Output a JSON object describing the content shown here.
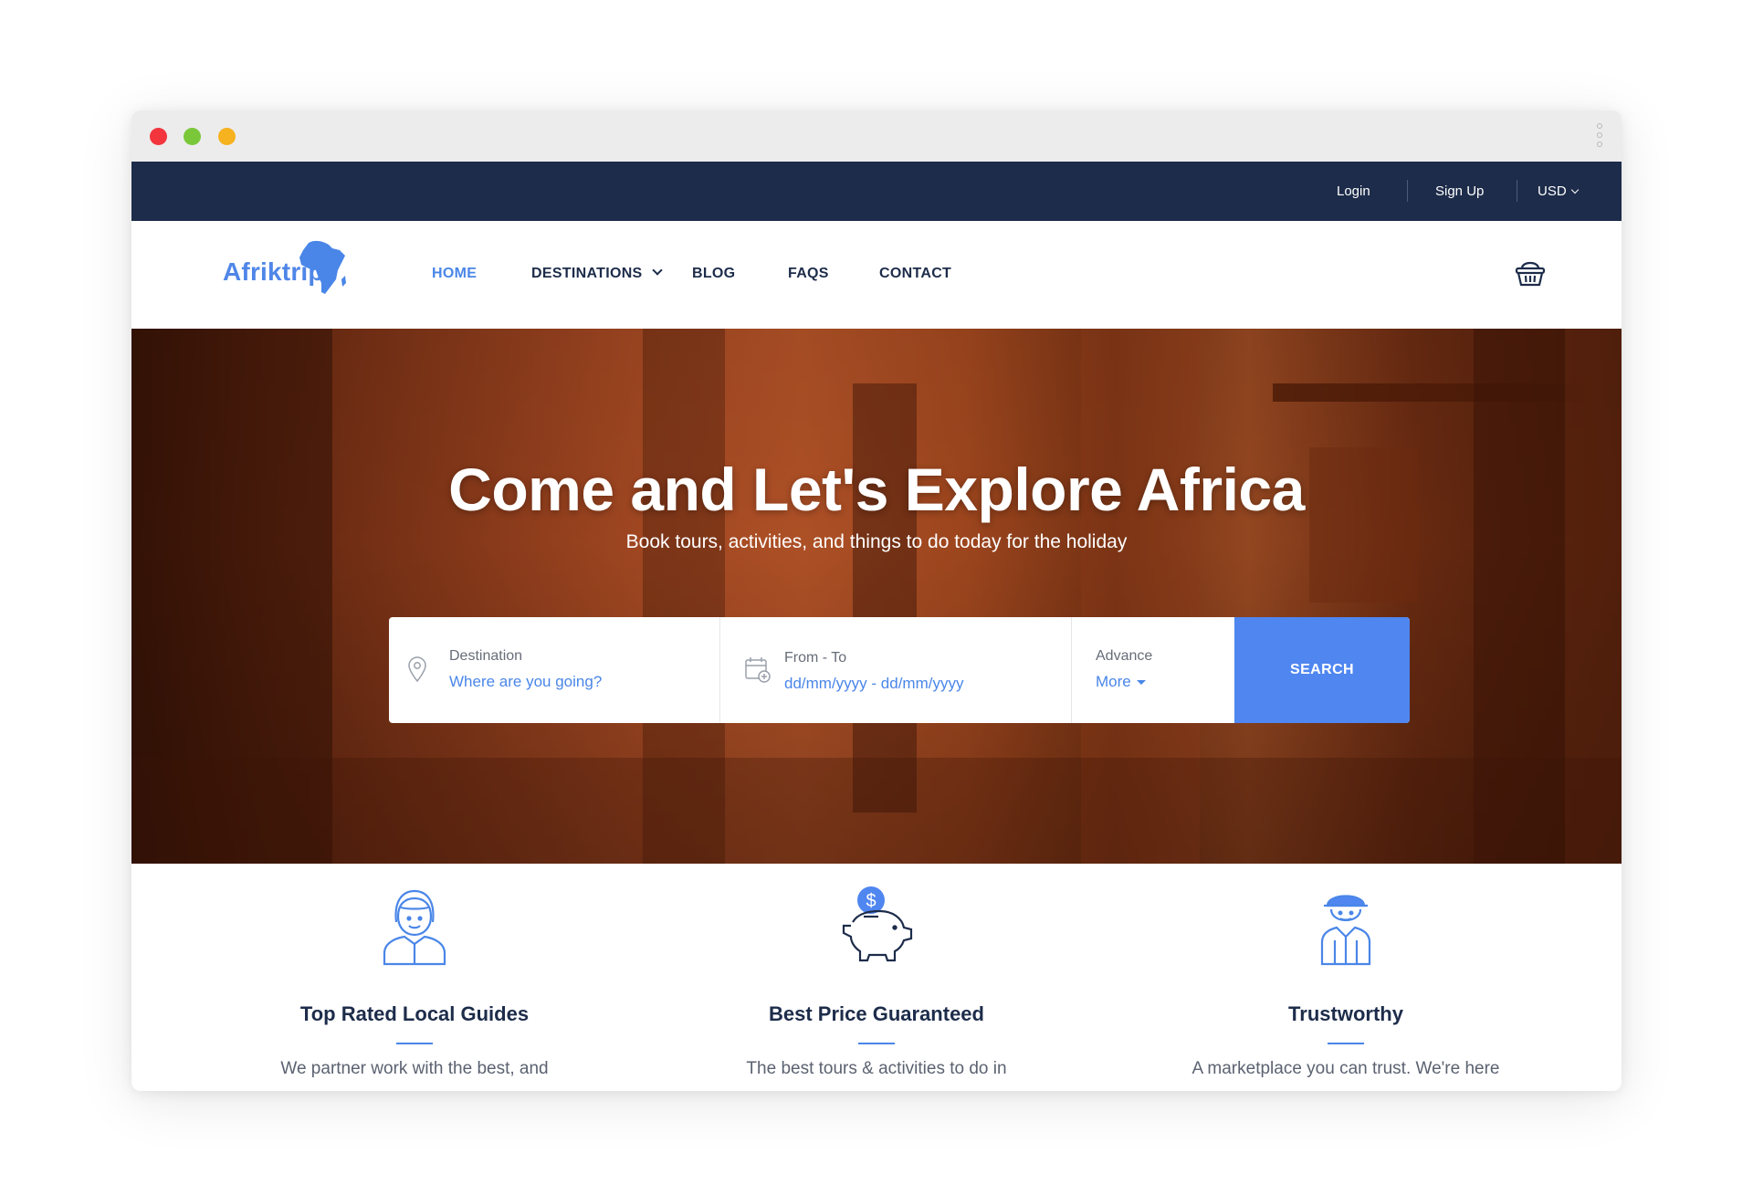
{
  "window": {
    "dots": [
      "red",
      "green",
      "yellow"
    ]
  },
  "topbar": {
    "login": "Login",
    "signup": "Sign Up",
    "currency": "USD"
  },
  "navbar": {
    "logo_text": "Afriktrip",
    "items": [
      {
        "label": "HOME",
        "active": true
      },
      {
        "label": "DESTINATIONS",
        "has_dropdown": true
      },
      {
        "label": "BLOG"
      },
      {
        "label": "FAQS"
      },
      {
        "label": "CONTACT"
      }
    ],
    "cart_icon": "basket-icon"
  },
  "hero": {
    "title": "Come and Let's Explore Africa",
    "subtitle": "Book tours, activities, and things to do today for the holiday"
  },
  "search": {
    "destination_label": "Destination",
    "destination_placeholder": "Where are you going?",
    "dates_label": "From - To",
    "dates_placeholder": "dd/mm/yyyy - dd/mm/yyyy",
    "advance_label": "Advance",
    "advance_value": "More",
    "button": "SEARCH"
  },
  "features": [
    {
      "icon": "local-guide-icon",
      "title": "Top Rated Local Guides",
      "description": "We partner work with the best, and"
    },
    {
      "icon": "piggy-bank-icon",
      "title": "Best Price Guaranteed",
      "description": "The best tours & activities to do in"
    },
    {
      "icon": "trustworthy-worker-icon",
      "title": "Trustworthy",
      "description": "A marketplace you can trust. We're here"
    }
  ],
  "colors": {
    "topbar": "#1d2c4a",
    "accent": "#4a86e8",
    "search_button": "#4f86f0"
  }
}
